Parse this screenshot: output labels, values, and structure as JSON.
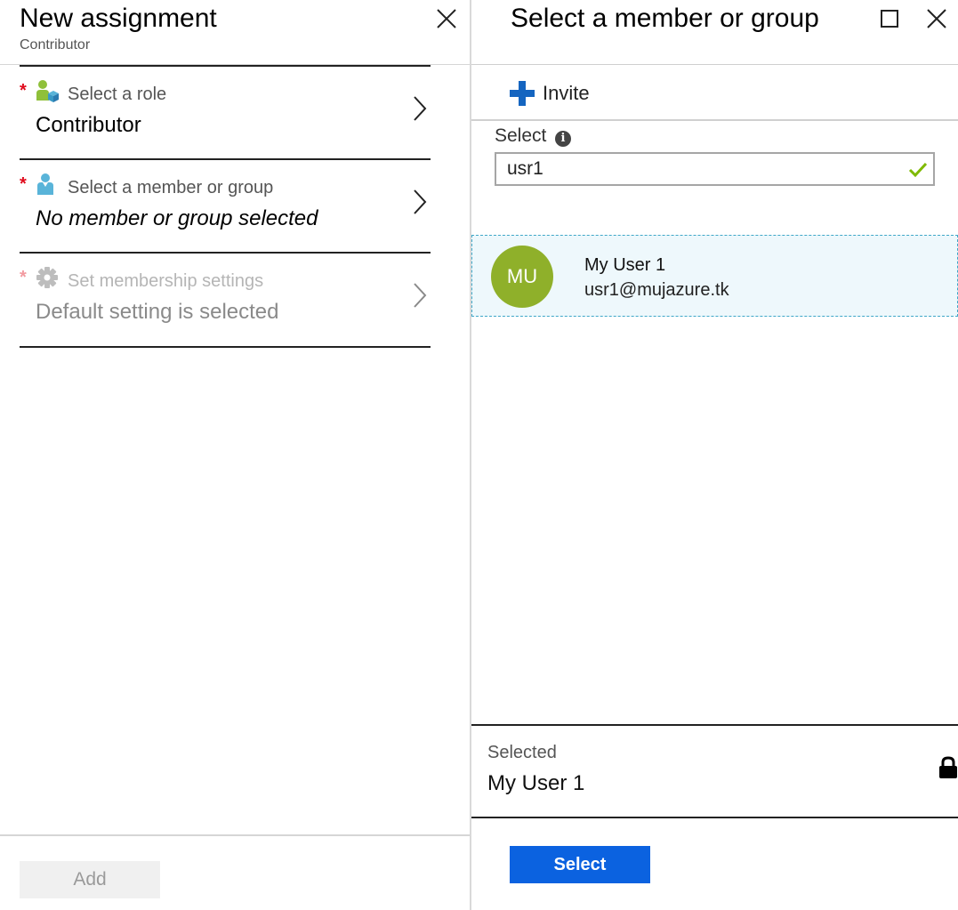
{
  "left_blade": {
    "title": "New assignment",
    "subtitle": "Contributor",
    "rows": [
      {
        "label": "Select a role",
        "value": "Contributor",
        "icon": "role-icon",
        "required": "*"
      },
      {
        "label": "Select a member or group",
        "value": "No member or group selected",
        "icon": "user-icon",
        "required": "*"
      },
      {
        "label": "Set membership settings",
        "value": "Default setting is selected",
        "icon": "gear-icon",
        "required": "*"
      }
    ],
    "add_label": "Add"
  },
  "right_blade": {
    "title": "Select a member or group",
    "invite_label": "Invite",
    "select_label": "Select",
    "search": {
      "value": "usr1"
    },
    "result": {
      "initials": "MU",
      "name": "My User 1",
      "email": "usr1@mujazure.tk"
    },
    "selected_label": "Selected",
    "selected_value": "My User 1",
    "select_button_label": "Select"
  },
  "colors": {
    "accent": "#0b62e0",
    "invite_plus": "#1565c0",
    "required": "#e00b1c",
    "avatar": "#8fb02a",
    "check": "#7fba00",
    "result_highlight": "#eef8fc"
  }
}
